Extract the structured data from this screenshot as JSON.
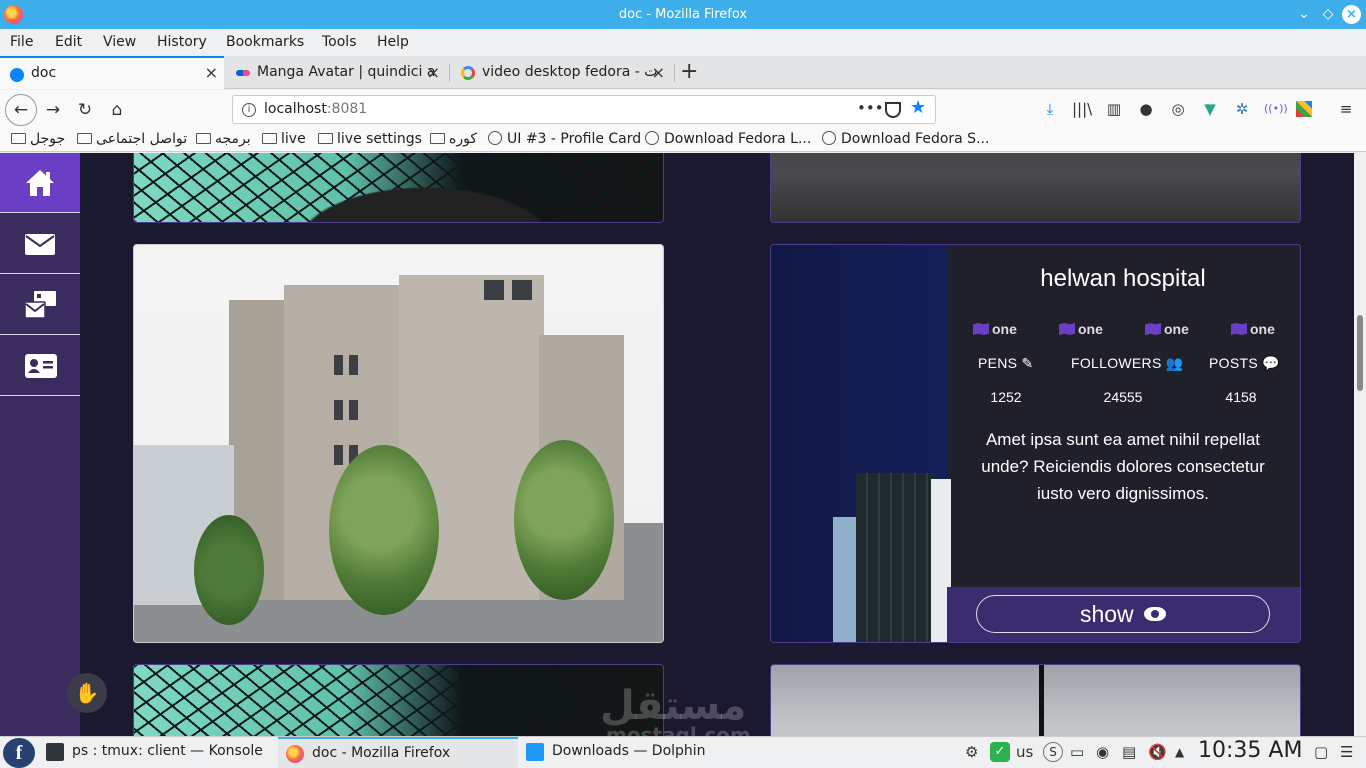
{
  "window": {
    "title": "doc - Mozilla Firefox",
    "controls": {
      "minimize": "⌄",
      "restore": "◇",
      "close": "×"
    }
  },
  "menu": [
    "File",
    "Edit",
    "View",
    "History",
    "Bookmarks",
    "Tools",
    "Help"
  ],
  "tabs": [
    {
      "title": "doc",
      "active": true,
      "favicon": "gear-icon",
      "favicon_color": "#0a84ff"
    },
    {
      "title": "Manga Avatar | quindici a",
      "active": false,
      "favicon": "dots-icon",
      "favicon_color": "#ea4c89"
    },
    {
      "title": "video desktop fedora - ‏ت",
      "active": false,
      "favicon": "google-icon",
      "favicon_color": "#4285f4"
    }
  ],
  "nav": {
    "url_host": "localhost",
    "url_port": ":8081"
  },
  "bookmarks": [
    "جوجل",
    "تواصل اجتماعى",
    "برمجه",
    "live",
    "live settings",
    "كوره",
    "UI #3 - Profile Card",
    "Download Fedora L...",
    "Download Fedora S..."
  ],
  "sidebar": {
    "items": [
      {
        "icon": "home-icon",
        "active": true
      },
      {
        "icon": "envelope-icon",
        "active": false
      },
      {
        "icon": "mail-bulk-icon",
        "active": false
      },
      {
        "icon": "address-card-icon",
        "active": false
      }
    ]
  },
  "profile": {
    "name": "helwan hospital",
    "tags": [
      "one",
      "one",
      "one",
      "one"
    ],
    "stats": [
      {
        "label": "PENS",
        "value": "1252",
        "icon": "edit-icon"
      },
      {
        "label": "FOLLOWERS",
        "value": "24555",
        "icon": "users-icon"
      },
      {
        "label": "POSTS",
        "value": "4158",
        "icon": "comments-icon"
      }
    ],
    "description": "Amet ipsa sunt ea amet nihil repellat unde? Reiciendis dolores consectetur iusto vero dignissimos.",
    "button_label": "show"
  },
  "watermark": {
    "text": "مستقل",
    "sub": "mostaql.com"
  },
  "taskbar": {
    "tasks": [
      {
        "title": "ps : tmux: client — Konsole",
        "active": false
      },
      {
        "title": "doc - Mozilla Firefox",
        "active": true
      },
      {
        "title": "Downloads — Dolphin",
        "active": false
      }
    ],
    "keyboard_layout": "us",
    "clock": "10:35 AM"
  },
  "colors": {
    "titlebar": "#3daee9",
    "page_background": "#1b1930",
    "sidebar": "#3a2c5e",
    "accent_purple": "#6a3fc4"
  }
}
